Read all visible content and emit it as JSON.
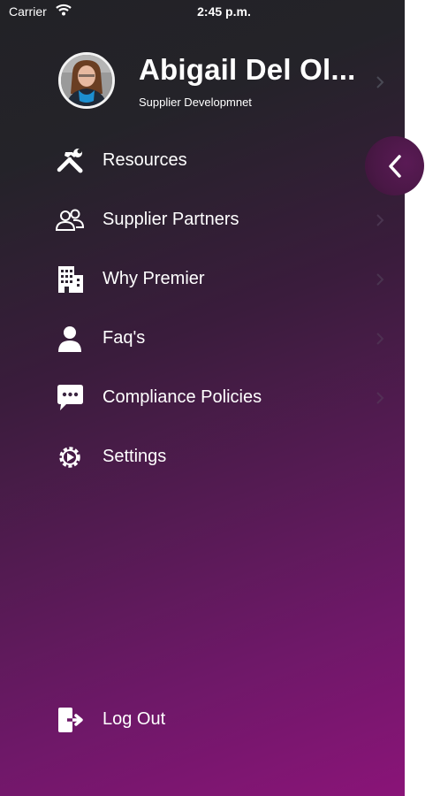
{
  "status_bar": {
    "carrier": "Carrier",
    "time": "2:45 p.m."
  },
  "profile": {
    "name": "Abigail Del Ol...",
    "role": "Supplier Developmnet"
  },
  "menu": {
    "items": [
      {
        "label": "Resources",
        "icon": "tools-icon"
      },
      {
        "label": "Supplier Partners",
        "icon": "people-icon"
      },
      {
        "label": "Why Premier",
        "icon": "building-icon"
      },
      {
        "label": "Faq's",
        "icon": "person-icon"
      },
      {
        "label": "Compliance Policies",
        "icon": "chat-icon"
      },
      {
        "label": "Settings",
        "icon": "gear-icon"
      }
    ],
    "logout": {
      "label": "Log Out",
      "icon": "logout-icon"
    }
  },
  "colors": {
    "drawer_top": "#222226",
    "drawer_bottom": "#8a1478",
    "text": "#ffffff",
    "back_button": "#4a1846"
  }
}
